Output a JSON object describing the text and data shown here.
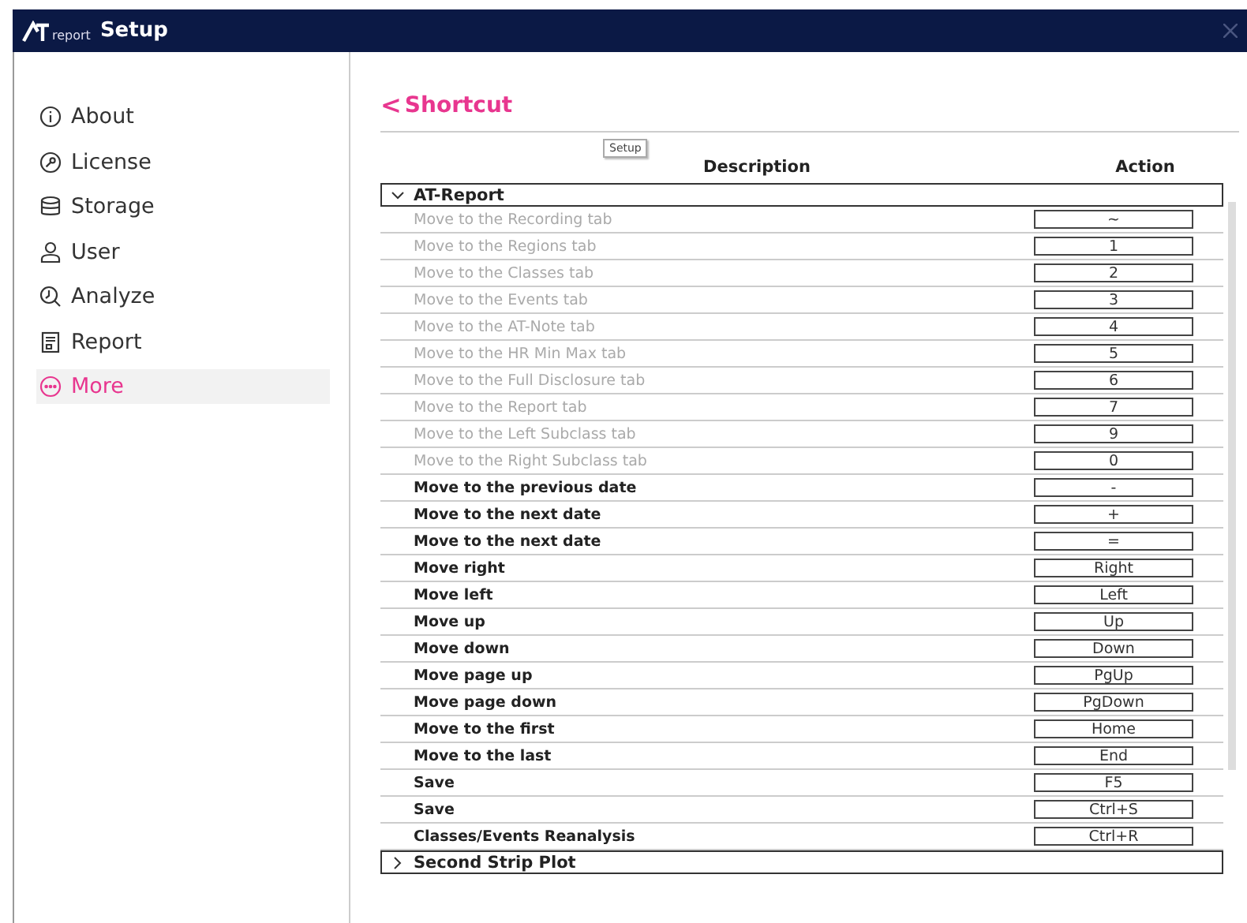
{
  "window": {
    "logo": "report",
    "title": "Setup"
  },
  "sidebar": {
    "items": [
      {
        "label": "About",
        "selected": false
      },
      {
        "label": "License",
        "selected": false
      },
      {
        "label": "Storage",
        "selected": false
      },
      {
        "label": "User",
        "selected": false
      },
      {
        "label": "Analyze",
        "selected": false
      },
      {
        "label": "Report",
        "selected": false
      },
      {
        "label": "More",
        "selected": true
      }
    ]
  },
  "page": {
    "back": "<",
    "title": "Shortcut"
  },
  "tooltip": "Setup",
  "table": {
    "columns": [
      "Description",
      "Action"
    ],
    "groups": [
      {
        "name": "AT-Report",
        "expanded": true,
        "rows": [
          {
            "description": "Move to the Recording tab",
            "key": "~",
            "disabled": true
          },
          {
            "description": "Move to the Regions tab",
            "key": "1",
            "disabled": true
          },
          {
            "description": "Move to the Classes tab",
            "key": "2",
            "disabled": true
          },
          {
            "description": "Move to the Events tab",
            "key": "3",
            "disabled": true
          },
          {
            "description": "Move to the AT-Note tab",
            "key": "4",
            "disabled": true
          },
          {
            "description": "Move to the HR Min Max tab",
            "key": "5",
            "disabled": true
          },
          {
            "description": "Move to the Full Disclosure tab",
            "key": "6",
            "disabled": true
          },
          {
            "description": "Move to the Report tab",
            "key": "7",
            "disabled": true
          },
          {
            "description": "Move to the Left Subclass tab",
            "key": "9",
            "disabled": true
          },
          {
            "description": "Move to the Right Subclass tab",
            "key": "0",
            "disabled": true
          },
          {
            "description": "Move to the previous date",
            "key": "-",
            "disabled": false
          },
          {
            "description": "Move to the next date",
            "key": "+",
            "disabled": false
          },
          {
            "description": "Move to the next date",
            "key": "=",
            "disabled": false
          },
          {
            "description": "Move right",
            "key": "Right",
            "disabled": false
          },
          {
            "description": "Move left",
            "key": "Left",
            "disabled": false
          },
          {
            "description": "Move up",
            "key": "Up",
            "disabled": false
          },
          {
            "description": "Move down",
            "key": "Down",
            "disabled": false
          },
          {
            "description": "Move page up",
            "key": "PgUp",
            "disabled": false
          },
          {
            "description": "Move page down",
            "key": "PgDown",
            "disabled": false
          },
          {
            "description": "Move to the first",
            "key": "Home",
            "disabled": false
          },
          {
            "description": "Move to the last",
            "key": "End",
            "disabled": false
          },
          {
            "description": "Save",
            "key": "F5",
            "disabled": false
          },
          {
            "description": "Save",
            "key": "Ctrl+S",
            "disabled": false
          },
          {
            "description": "Classes/Events Reanalysis",
            "key": "Ctrl+R",
            "disabled": false
          }
        ]
      },
      {
        "name": "Second Strip Plot",
        "expanded": false
      }
    ]
  }
}
